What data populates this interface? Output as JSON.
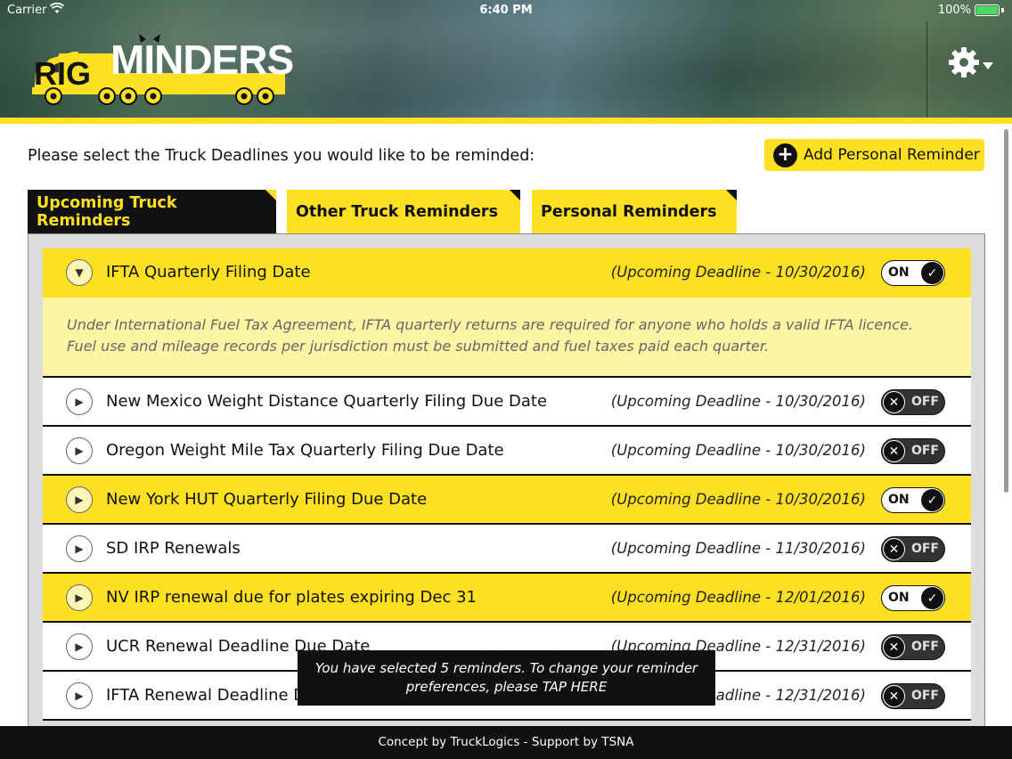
{
  "status_bar": {
    "carrier": "Carrier",
    "time": "6:40 PM",
    "battery": "100%"
  },
  "header": {
    "logo_rig": "RIG",
    "logo_minders": "MINDERS",
    "settings_icon": "gear-icon"
  },
  "prompt": "Please select the Truck Deadlines you would like to be reminded:",
  "add_button": {
    "label": "Add Personal Reminder",
    "icon": "plus-icon"
  },
  "tabs": [
    {
      "label": "Upcoming Truck Reminders",
      "active": true
    },
    {
      "label": "Other Truck Reminders",
      "active": false
    },
    {
      "label": "Personal Reminders",
      "active": false
    }
  ],
  "reminders": [
    {
      "title": "IFTA Quarterly Filing Date",
      "deadline": "(Upcoming Deadline - 10/30/2016)",
      "state": "ON",
      "expanded": true,
      "description": "Under International Fuel Tax Agreement, IFTA quarterly returns are required for anyone who holds a valid IFTA licence. Fuel use and mileage records per jurisdiction must be submitted and fuel taxes paid each quarter."
    },
    {
      "title": "New Mexico Weight Distance Quarterly Filing Due Date",
      "deadline": "(Upcoming Deadline - 10/30/2016)",
      "state": "OFF"
    },
    {
      "title": "Oregon Weight Mile Tax Quarterly Filing Due Date",
      "deadline": "(Upcoming Deadline - 10/30/2016)",
      "state": "OFF"
    },
    {
      "title": "New York HUT Quarterly Filing Due Date",
      "deadline": "(Upcoming Deadline - 10/30/2016)",
      "state": "ON"
    },
    {
      "title": "SD IRP Renewals",
      "deadline": "(Upcoming Deadline - 11/30/2016)",
      "state": "OFF"
    },
    {
      "title": "NV IRP renewal due for plates expiring Dec 31",
      "deadline": "(Upcoming Deadline - 12/01/2016)",
      "state": "ON"
    },
    {
      "title": "UCR Renewal Deadline Due Date",
      "deadline": "(Upcoming Deadline - 12/31/2016)",
      "state": "OFF"
    },
    {
      "title": "IFTA Renewal Deadline Due Date",
      "deadline": "(Upcoming Deadline - 12/31/2016)",
      "state": "OFF"
    }
  ],
  "toast": {
    "line1": "You have selected 5 reminders. To change your reminder",
    "line2": "preferences, please TAP HERE"
  },
  "footer": "Concept by TruckLogics - Support by TSNA",
  "colors": {
    "accent": "#fde022",
    "dark": "#111111",
    "description_bg": "#fdf4a4"
  }
}
